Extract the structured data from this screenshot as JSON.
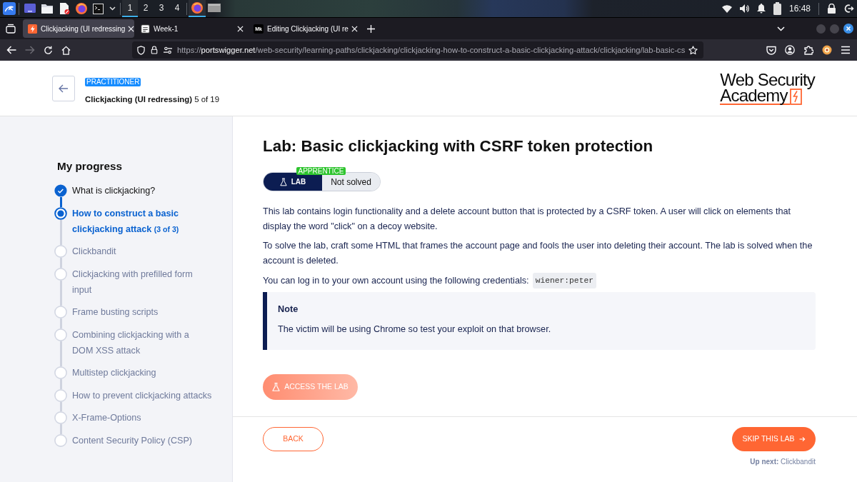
{
  "taskbar": {
    "workspaces": [
      {
        "label": "1",
        "selected": true
      },
      {
        "label": "2",
        "selected": false
      },
      {
        "label": "3",
        "selected": false
      },
      {
        "label": "4",
        "selected": false
      }
    ],
    "tasks": [
      {
        "kind": "browser",
        "selected": true
      },
      {
        "kind": "window",
        "selected": false
      }
    ],
    "clock": "16:48"
  },
  "browser": {
    "tabs": [
      {
        "kind": "bolt",
        "title": "Clickjacking (UI redressing",
        "selected": true
      },
      {
        "kind": "page",
        "title": "Week-1",
        "selected": false
      },
      {
        "kind": "text",
        "favicon_text": "Mk",
        "title": "Editing Clickjacking (UI re",
        "selected": false
      }
    ],
    "forward_disabled": true,
    "url": {
      "scheme": "https://",
      "host": "portswigger.net",
      "path": "/web-security/learning-paths/clickjacking/clickjacking-how-to-construct-a-basic-clickjacking-attack/clickjacking/lab-basic-cs"
    }
  },
  "header": {
    "level": "PRACTITIONER",
    "topic": "**Clickjacking (UI redressing)** 5 of 19",
    "logo": {
      "line_1": "Web Security",
      "line_2": "Academy"
    }
  },
  "sidebar": {
    "title": "My progress",
    "steps": [
      {
        "label": "What is clickjacking?",
        "completed": true,
        "selected": false
      },
      {
        "label": "How to construct a basic clickjacking attack",
        "count": "(3 of 3)",
        "completed": false,
        "selected": true
      },
      {
        "label": "Clickbandit",
        "completed": false,
        "selected": false
      },
      {
        "label": "Clickjacking with prefilled form input",
        "completed": false,
        "selected": false
      },
      {
        "label": "Frame busting scripts",
        "completed": false,
        "selected": false
      },
      {
        "label": "Combining clickjacking with a DOM XSS attack",
        "completed": false,
        "selected": false
      },
      {
        "label": "Multistep clickjacking",
        "completed": false,
        "selected": false
      },
      {
        "label": "How to prevent clickjacking attacks",
        "completed": false,
        "selected": false
      },
      {
        "label": "X-Frame-Options",
        "completed": false,
        "selected": false
      },
      {
        "label": "Content Security Policy (CSP)",
        "completed": false,
        "selected": false
      }
    ]
  },
  "lab": {
    "title": "Lab: Basic clickjacking with CSRF token protection",
    "badge": {
      "label": "LAB",
      "level": "APPRENTICE",
      "status": "Not solved"
    },
    "paragraphs": [
      {
        "text": "This lab contains login functionality and a delete account button that is protected by a CSRF token. A user will click on elements that display the word \"click\" on a decoy website."
      },
      {
        "text": "To solve the lab, craft some HTML that frames the account page and fools the user into deleting their account. The lab is solved when the account is deleted."
      },
      {
        "text": "You can log in to your own account using the following credentials:",
        "code": "wiener:peter"
      }
    ],
    "note": {
      "title": "Note",
      "text": "The victim will be using Chrome so test your exploit on that browser."
    },
    "access_button": "ACCESS THE LAB"
  },
  "footer": {
    "back_button": "BACK",
    "skip_button": "SKIP THIS LAB",
    "up_next": "**Up next:** Clickbandit"
  }
}
